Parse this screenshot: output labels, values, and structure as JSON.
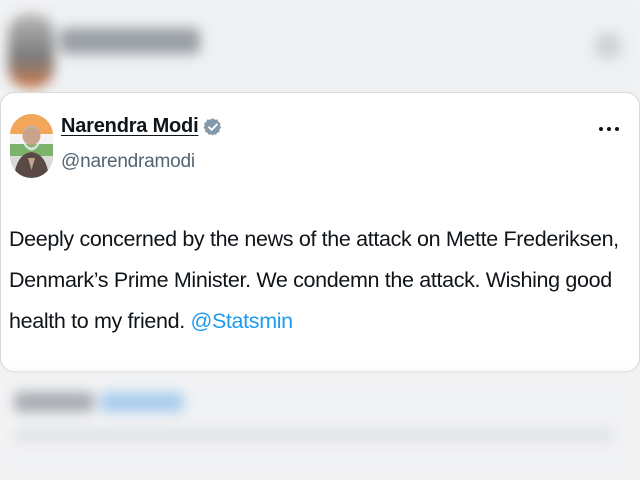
{
  "tweet": {
    "author_name": "Narendra Modi",
    "handle": "@narendramodi",
    "verified": true,
    "text_before_mention": "Deeply concerned by the news of the attack on Mette Frederiksen, Denmark’s Prime Minister. We condemn the attack. Wishing good health to my friend. ",
    "mention": "@Statsmin",
    "mention_color": "#1d9bf0"
  },
  "icons": {
    "verified": "verified-badge-icon",
    "more": "more-options-icon"
  }
}
